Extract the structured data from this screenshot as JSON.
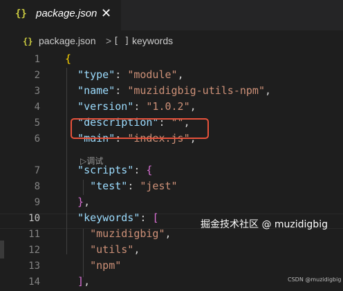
{
  "tab": {
    "icon": "{}",
    "title": "package.json",
    "close": "✕"
  },
  "breadcrumb": {
    "icon": "{}",
    "file": "package.json",
    "separator": ">",
    "array_icon": "[ ]",
    "keywords": "keywords"
  },
  "codelens": "▷调试",
  "watermark": "掘金技术社区 @ muzidigbig",
  "credit": "CSDN @muzidigbig",
  "editor": {
    "active_line": 10,
    "lines": [
      {
        "n": "1",
        "parts": [
          [
            "b1",
            "{"
          ]
        ]
      },
      {
        "n": "2",
        "parts": [
          [
            "k",
            "  \"type\""
          ],
          [
            "p",
            ": "
          ],
          [
            "s",
            "\"module\""
          ],
          [
            "p",
            ","
          ]
        ]
      },
      {
        "n": "3",
        "parts": [
          [
            "k",
            "  \"name\""
          ],
          [
            "p",
            ": "
          ],
          [
            "s",
            "\"muzidigbig-utils-npm\""
          ],
          [
            "p",
            ","
          ]
        ]
      },
      {
        "n": "4",
        "parts": [
          [
            "k",
            "  \"version\""
          ],
          [
            "p",
            ": "
          ],
          [
            "s",
            "\"1.0.2\""
          ],
          [
            "p",
            ","
          ]
        ]
      },
      {
        "n": "5",
        "parts": [
          [
            "k",
            "  \"description\""
          ],
          [
            "p",
            ": "
          ],
          [
            "s",
            "\"\""
          ],
          [
            "p",
            ","
          ]
        ]
      },
      {
        "n": "6",
        "parts": [
          [
            "k",
            "  \"main\""
          ],
          [
            "p",
            ": "
          ],
          [
            "s",
            "\"index.js\""
          ],
          [
            "p",
            ","
          ]
        ]
      },
      {
        "n": "7",
        "parts": [
          [
            "k",
            "  \"scripts\""
          ],
          [
            "p",
            ": "
          ],
          [
            "b2",
            "{"
          ]
        ]
      },
      {
        "n": "8",
        "parts": [
          [
            "k",
            "    \"test\""
          ],
          [
            "p",
            ": "
          ],
          [
            "s",
            "\"jest\""
          ]
        ]
      },
      {
        "n": "9",
        "parts": [
          [
            "b2",
            "  }"
          ],
          [
            "p",
            ","
          ]
        ]
      },
      {
        "n": "10",
        "parts": [
          [
            "k",
            "  \"keywords\""
          ],
          [
            "p",
            ": "
          ],
          [
            "b2",
            "["
          ]
        ]
      },
      {
        "n": "11",
        "parts": [
          [
            "s",
            "    \"muzidigbig\""
          ],
          [
            "p",
            ","
          ]
        ]
      },
      {
        "n": "12",
        "parts": [
          [
            "s",
            "    \"utils\""
          ],
          [
            "p",
            ","
          ]
        ]
      },
      {
        "n": "13",
        "parts": [
          [
            "s",
            "    \"npm\""
          ]
        ]
      },
      {
        "n": "14",
        "parts": [
          [
            "b2",
            "  ]"
          ],
          [
            "p",
            ","
          ]
        ]
      }
    ]
  }
}
